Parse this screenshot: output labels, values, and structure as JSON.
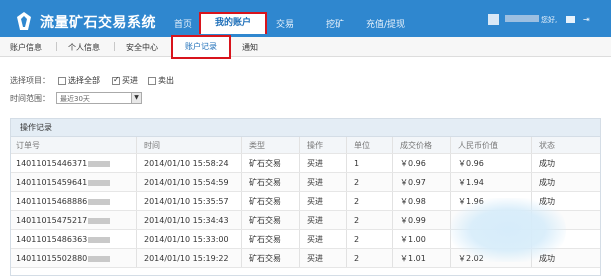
{
  "header": {
    "logo_text": "流量矿石交易系统",
    "nav": [
      "首页",
      "我的账户",
      "交易",
      "挖矿",
      "充值/提现"
    ],
    "active_nav": "我的账户",
    "greeting": "您好,"
  },
  "subnav": {
    "items": [
      "账户信息",
      "个人信息",
      "安全中心",
      "账户记录",
      "通知"
    ],
    "active": "账户记录"
  },
  "filters": {
    "select_label": "选择项目：",
    "options": [
      {
        "label": "选择全部",
        "checked": false
      },
      {
        "label": "买进",
        "checked": true
      },
      {
        "label": "卖出",
        "checked": false
      }
    ],
    "time_label": "时间范围：",
    "time_value": "最近30天"
  },
  "table": {
    "title": "操作记录",
    "columns": [
      "订单号",
      "时间",
      "类型",
      "操作",
      "单位",
      "成交价格",
      "人民币价值",
      "状态"
    ],
    "rows": [
      [
        "14011015446371",
        "2014/01/10 15:58:24",
        "矿石交易",
        "买进",
        "1",
        "￥0.96",
        "￥0.96",
        "成功"
      ],
      [
        "14011015459641",
        "2014/01/10 15:54:59",
        "矿石交易",
        "买进",
        "2",
        "￥0.97",
        "￥1.94",
        "成功"
      ],
      [
        "14011015468886",
        "2014/01/10 15:35:57",
        "矿石交易",
        "买进",
        "2",
        "￥0.98",
        "￥1.96",
        "成功"
      ],
      [
        "14011015475217",
        "2014/01/10 15:34:43",
        "矿石交易",
        "买进",
        "2",
        "￥0.99",
        "",
        ""
      ],
      [
        "14011015486363",
        "2014/01/10 15:33:00",
        "矿石交易",
        "买进",
        "2",
        "￥1.00",
        "",
        ""
      ],
      [
        "14011015502880",
        "2014/01/10 15:19:22",
        "矿石交易",
        "买进",
        "2",
        "￥1.01",
        "￥2.02",
        "成功"
      ]
    ]
  },
  "colors": {
    "header_bg": "#2f87cf",
    "highlight_border": "#d8141c",
    "link_blue": "#1e6fb9"
  }
}
